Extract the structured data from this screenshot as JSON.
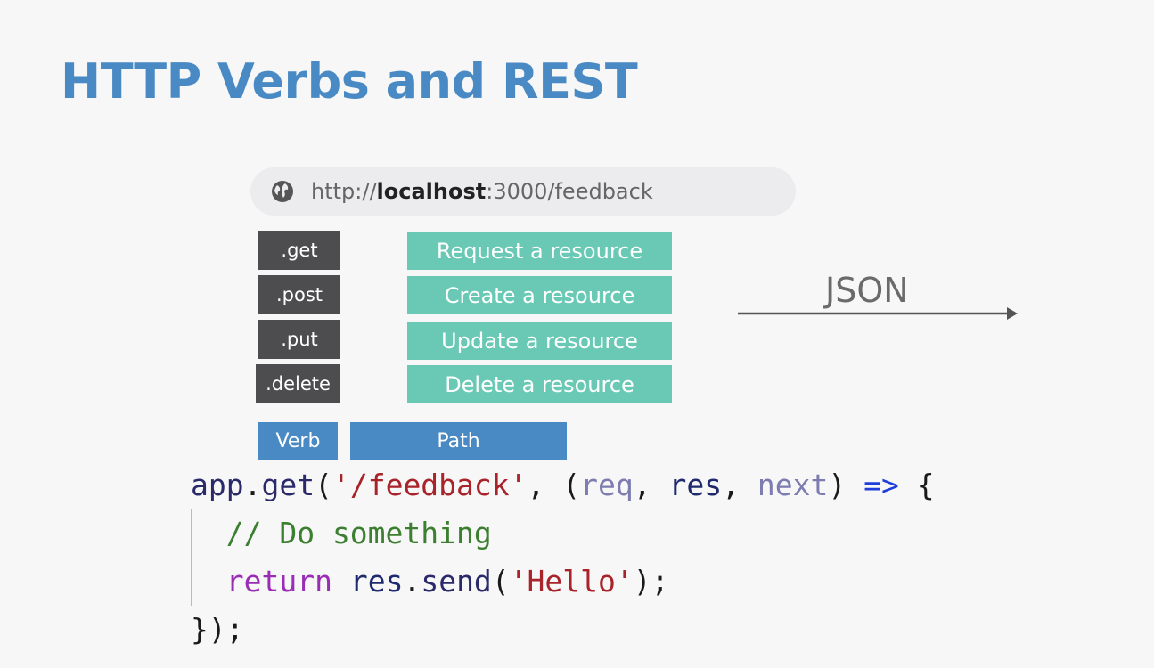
{
  "title": "HTTP Verbs and REST",
  "url": {
    "prefix": "http://",
    "host": "localhost",
    "rest": ":3000/feedback"
  },
  "verbs": [
    ".get",
    ".post",
    ".put",
    ".delete"
  ],
  "actions": [
    "Request a resource",
    "Create a resource",
    "Update a resource",
    "Delete a resource"
  ],
  "json_label": "JSON",
  "tags": {
    "verb": "Verb",
    "path": "Path"
  },
  "code": {
    "l1": {
      "app": "app",
      "dot": ".",
      "get": "get",
      "open": "(",
      "path": "'/feedback'",
      "comma1": ", (",
      "req": "req",
      "comma2": ", ",
      "res": "res",
      "comma3": ", ",
      "next": "next",
      "close": ") ",
      "arrow": "=>",
      "brace": " {"
    },
    "l2": "  // Do something",
    "l3": {
      "indent": "  ",
      "ret": "return",
      "space": " ",
      "res": "res",
      "dot": ".",
      "send": "send",
      "open": "(",
      "str": "'Hello'",
      "close": ");"
    },
    "l4": "});"
  },
  "colors": {
    "title": "#4a8ac4",
    "verb_bg": "#4d4d50",
    "action_bg": "#6ac9b5",
    "tag_bg": "#4a8ac4"
  },
  "icons": {
    "globe": "globe-icon",
    "arrow": "arrow-right-icon"
  }
}
